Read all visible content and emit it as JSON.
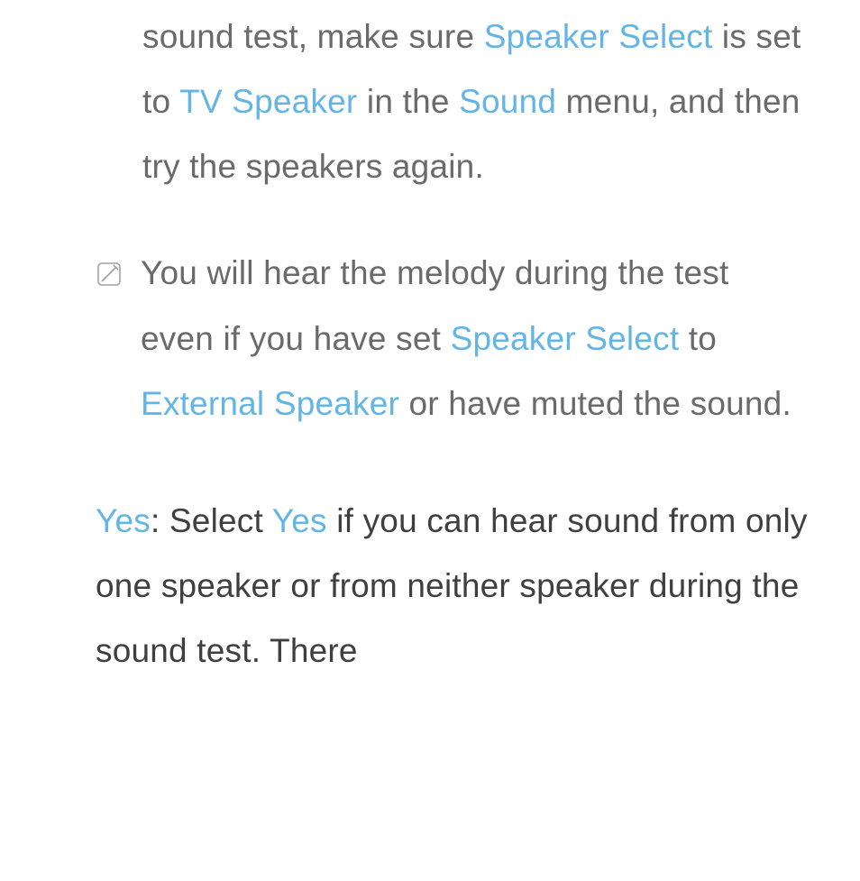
{
  "p1": {
    "t1": "sound test, make sure ",
    "hl1": "Speaker Select",
    "t2": " is set to ",
    "hl2": "TV Speaker",
    "t3": " in the ",
    "hl3": "Sound",
    "t4": " menu, and then try the speakers again."
  },
  "note": {
    "t1": "You will hear the melody during the test even if you have set ",
    "hl1": "Speaker Select",
    "t2": " to ",
    "hl2": "External Speaker",
    "t3": " or have muted the sound."
  },
  "p3": {
    "hl1": "Yes",
    "t1": ": Select ",
    "hl2": "Yes",
    "t2": " if you can hear sound from only one speaker or from neither speaker during the sound test. There"
  }
}
